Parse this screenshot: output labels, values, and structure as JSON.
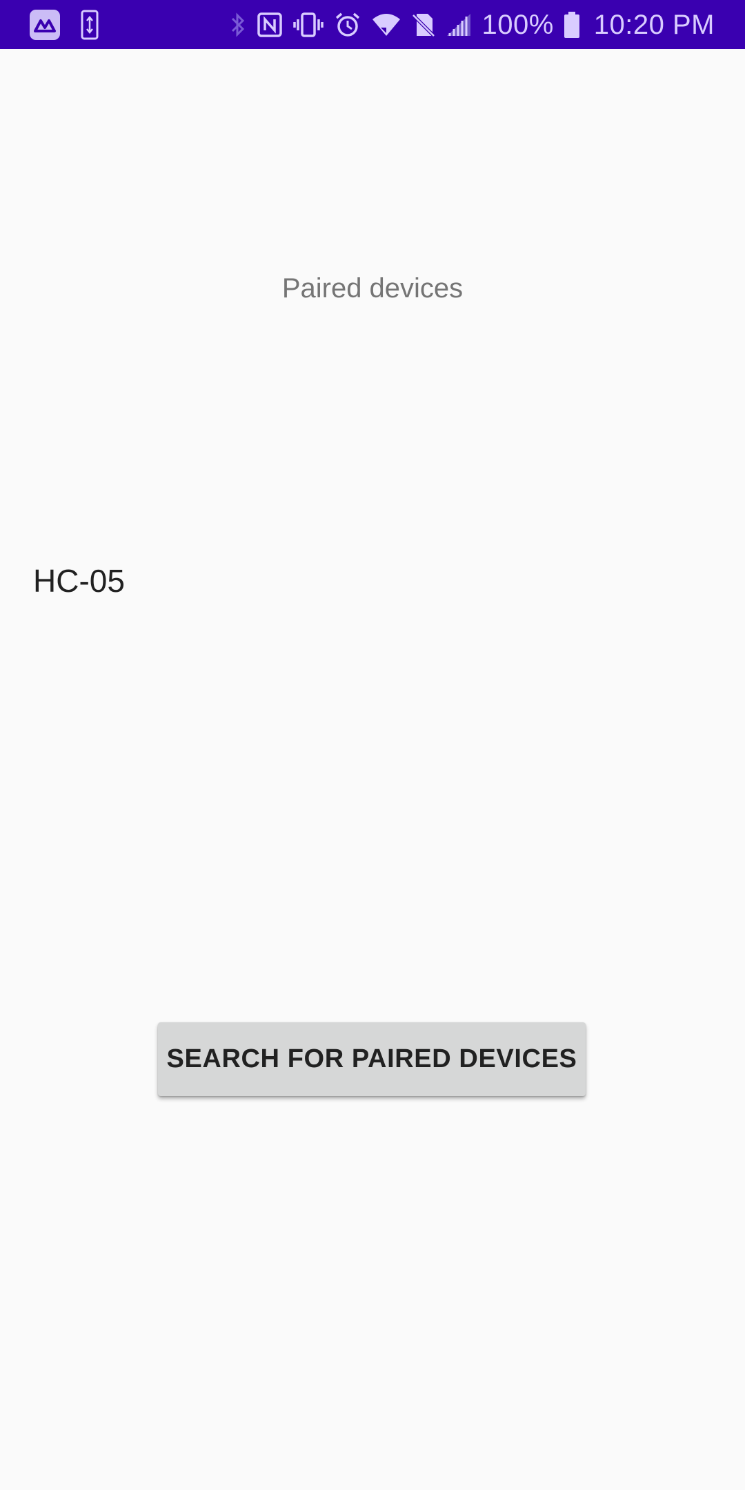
{
  "status_bar": {
    "left_icons": [
      "app-logo-icon",
      "phone-transfer-icon"
    ],
    "right_icons": [
      "bluetooth-icon",
      "nfc-icon",
      "vibrate-icon",
      "alarm-icon",
      "wifi-icon",
      "no-sim-icon",
      "signal-icon",
      "battery-icon"
    ],
    "battery_text": "100%",
    "time": "10:20 PM",
    "background_color": "#3a00b0"
  },
  "main": {
    "title": "Paired devices",
    "devices": [
      "HC-05"
    ],
    "search_button_label": "SEARCH FOR PAIRED DEVICES"
  }
}
